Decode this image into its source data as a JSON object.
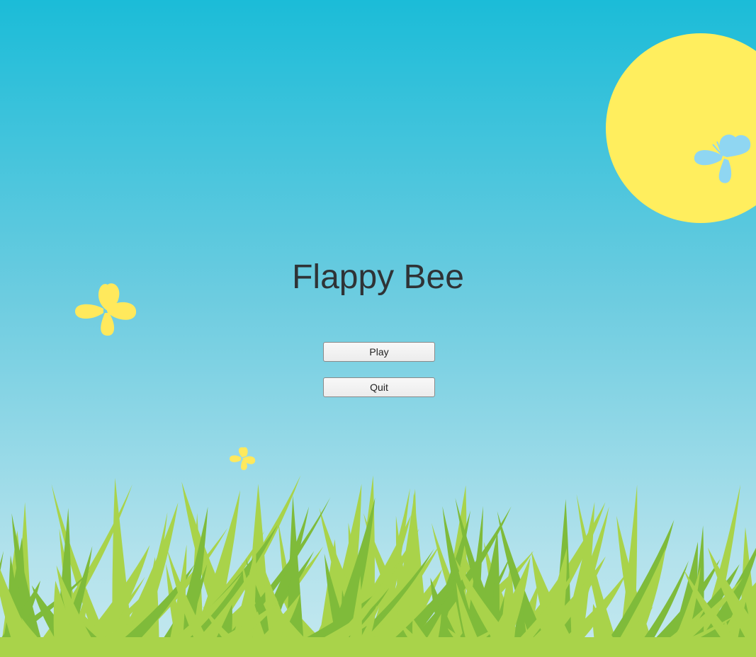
{
  "title": "Flappy Bee",
  "menu": {
    "play_label": "Play",
    "quit_label": "Quit"
  },
  "colors": {
    "sky_top": "#1bbcd8",
    "sky_bottom": "#b3e2ec",
    "sun": "#ffee5e",
    "butterfly_yellow": "#ffe95c",
    "butterfly_blue": "#8fd6f2",
    "grass_light": "#a9d34a",
    "grass_dark": "#7fbb3a"
  },
  "icons": {
    "sun": "sun-icon",
    "butterflies": [
      "butterfly-icon",
      "butterfly-icon",
      "butterfly-icon"
    ]
  }
}
